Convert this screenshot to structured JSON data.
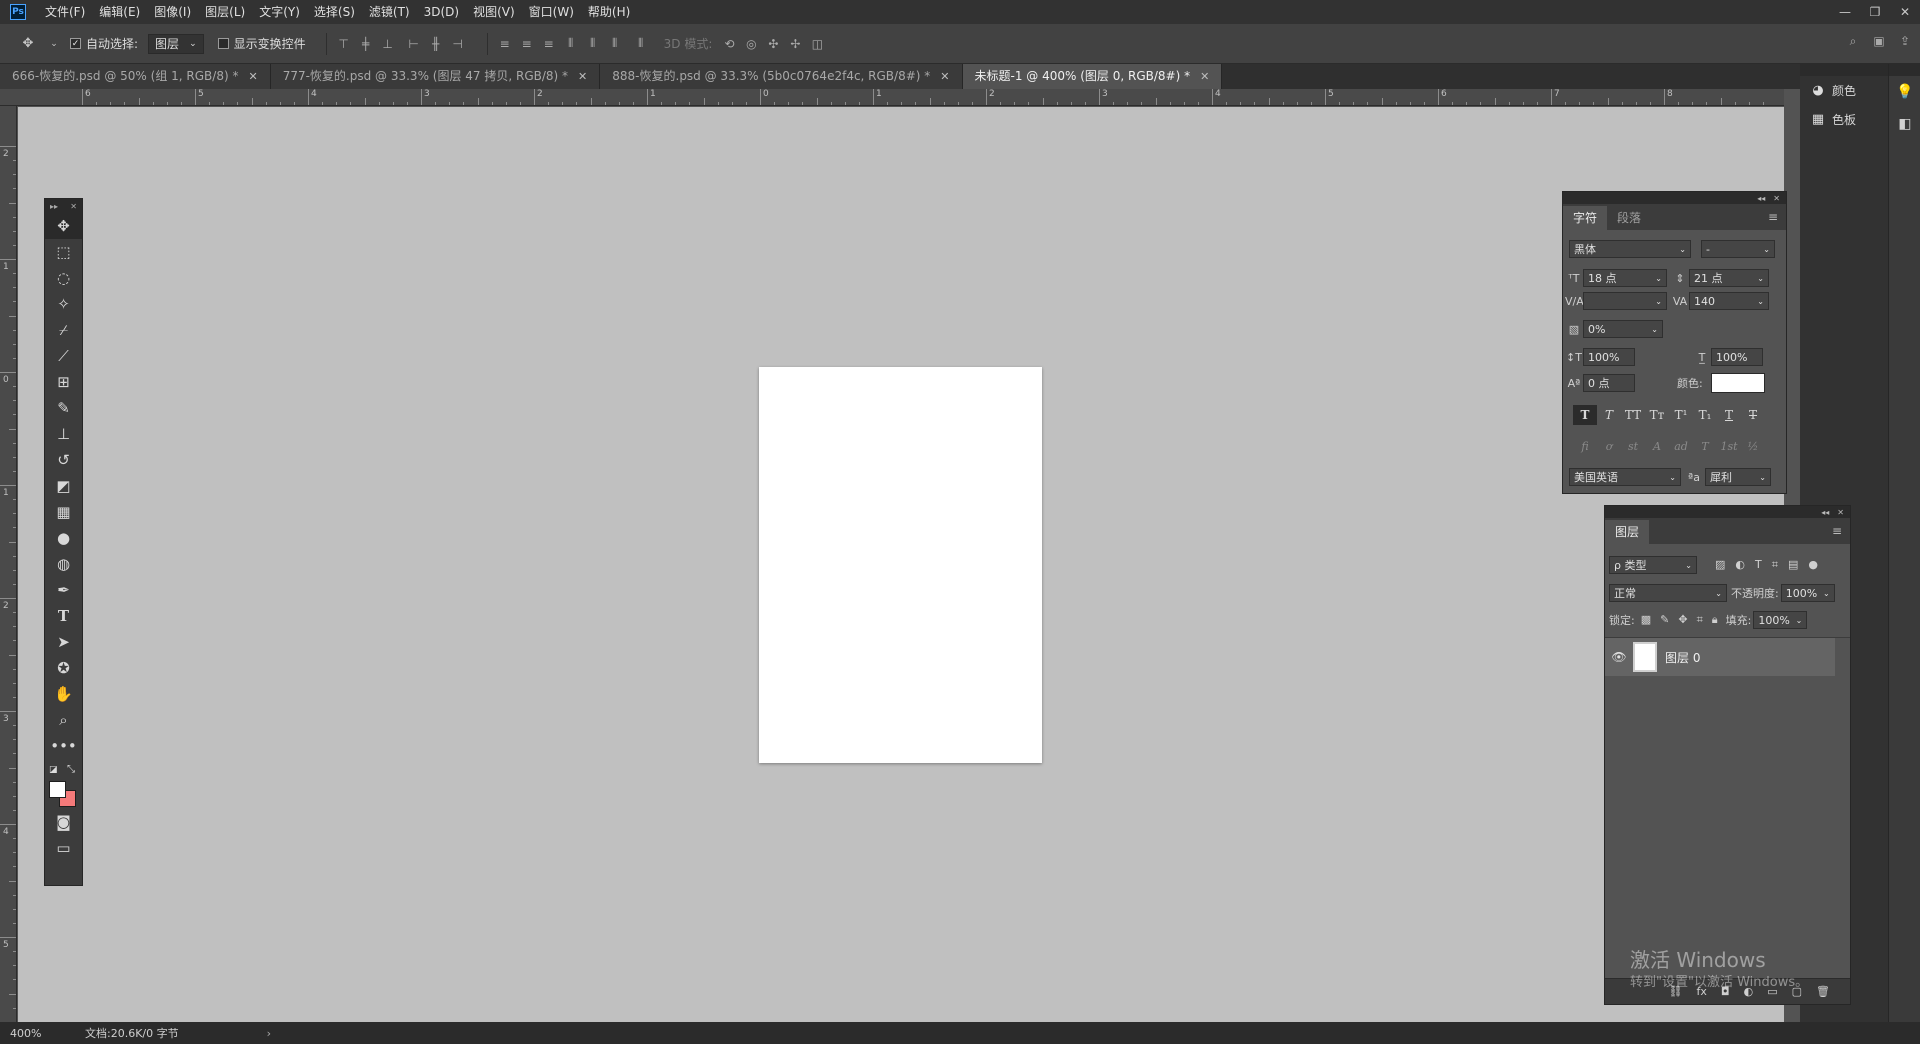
{
  "app": {
    "logo": "Ps"
  },
  "menu": [
    "文件(F)",
    "编辑(E)",
    "图像(I)",
    "图层(L)",
    "文字(Y)",
    "选择(S)",
    "滤镜(T)",
    "3D(D)",
    "视图(V)",
    "窗口(W)",
    "帮助(H)"
  ],
  "window_controls": {
    "minimize": "—",
    "restore": "❐",
    "close": "✕"
  },
  "options": {
    "auto_select_label": "自动选择:",
    "auto_select_value": "图层",
    "show_transform_label": "显示变换控件",
    "mode3d_label": "3D 模式:"
  },
  "tabs": [
    {
      "label": "666-恢复的.psd @ 50% (组 1, RGB/8) *"
    },
    {
      "label": "777-恢复的.psd @ 33.3% (图层 47 拷贝, RGB/8) *"
    },
    {
      "label": "888-恢复的.psd @ 33.3% (5b0c0764e2f4c, RGB/8#) *"
    },
    {
      "label": "未标题-1 @ 400% (图层 0, RGB/8#) *"
    }
  ],
  "ruler_h": [
    "6",
    "5",
    "4",
    "3",
    "2",
    "1",
    "0",
    "1",
    "2",
    "3",
    "4",
    "5",
    "6",
    "7",
    "8"
  ],
  "ruler_v": [
    "2",
    "1",
    "0",
    "1",
    "2",
    "3",
    "4",
    "5"
  ],
  "dock": {
    "color_label": "颜色",
    "swatches_label": "色板"
  },
  "character": {
    "tab_character": "字符",
    "tab_paragraph": "段落",
    "font_family": "黑体",
    "font_style": "-",
    "font_size": "18 点",
    "leading": "21 点",
    "kerning": "",
    "tracking": "140",
    "tsume": "0%",
    "vscale": "100%",
    "hscale": "100%",
    "baseline": "0 点",
    "color_label": "颜色:",
    "color_value": "#ffffff",
    "format_buttons": [
      "T",
      "T",
      "TT",
      "Tт",
      "T¹",
      "T₁",
      "T",
      "T"
    ],
    "opentype_buttons": [
      "fi",
      "ơ",
      "st",
      "A",
      "ad",
      "T",
      "1st",
      "½"
    ],
    "language": "美国英语",
    "aa_icon": "ªa",
    "antialias": "犀利"
  },
  "layers": {
    "tab_label": "图层",
    "filter_label": "ρ 类型",
    "blend_mode": "正常",
    "opacity_label": "不透明度:",
    "opacity_value": "100%",
    "lock_label": "锁定:",
    "fill_label": "填充:",
    "fill_value": "100%",
    "items": [
      {
        "name": "图层 0",
        "visible": true
      }
    ],
    "footer_icons": [
      "fx",
      "◘",
      "◐",
      "▭",
      "▢",
      "🗑"
    ]
  },
  "watermark": {
    "line1": "激活 Windows",
    "line2": "转到\"设置\"以激活 Windows。"
  },
  "status": {
    "zoom": "400%",
    "doc": "文档:20.6K/0 字节",
    "arrow": "›"
  }
}
